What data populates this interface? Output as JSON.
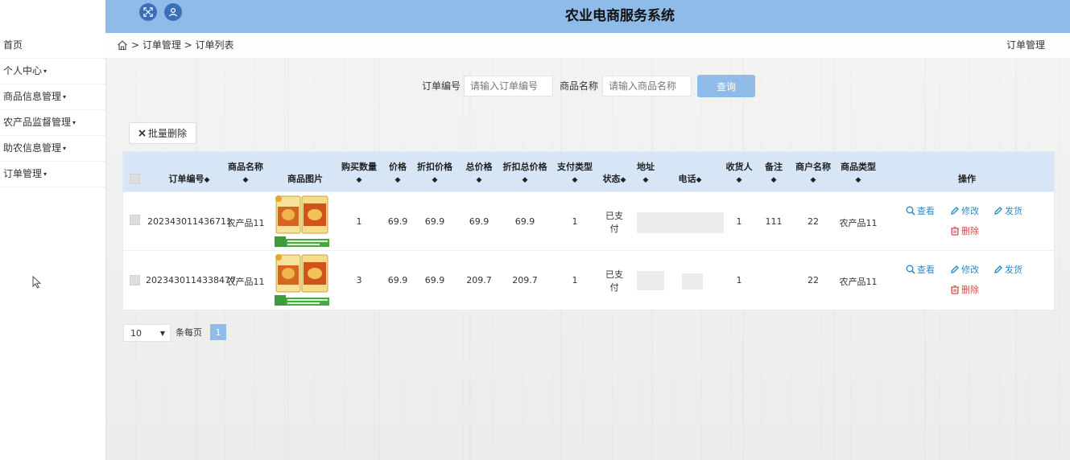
{
  "app": {
    "title": "农业电商服务系统"
  },
  "sidebar": {
    "items": [
      {
        "label": "首页",
        "caret": false
      },
      {
        "label": "个人中心",
        "caret": true
      },
      {
        "label": "商品信息管理",
        "caret": true
      },
      {
        "label": "农产品监督管理",
        "caret": true
      },
      {
        "label": "助农信息管理",
        "caret": true
      },
      {
        "label": "订单管理",
        "caret": true
      }
    ],
    "caret_glyph": "▾"
  },
  "breadcrumb": {
    "path": "> 订单管理 > 订单列表",
    "right_label": "订单管理"
  },
  "search": {
    "order_no_label": "订单编号",
    "order_no_placeholder": "请输入订单编号",
    "goods_name_label": "商品名称",
    "goods_name_placeholder": "请输入商品名称",
    "query_label": "查询"
  },
  "toolbar": {
    "batch_delete_label": "批量删除"
  },
  "table": {
    "sort_glyph": "◆",
    "columns": {
      "order_no": "订单编号",
      "goods_name": "商品名称",
      "goods_image": "商品图片",
      "quantity": "购买数量",
      "price": "价格",
      "discount_price": "折扣价格",
      "total": "总价格",
      "discount_total": "折扣总价格",
      "pay_type": "支付类型",
      "status": "状态",
      "address": "地址",
      "phone": "电话",
      "receiver": "收货人",
      "remark": "备注",
      "merchant": "商户名称",
      "goods_type": "商品类型",
      "actions": "操作"
    },
    "rows": [
      {
        "order_no": "202343011436711",
        "goods_name": "农产品11",
        "quantity": "1",
        "price": "69.9",
        "discount_price": "69.9",
        "total": "69.9",
        "discount_total": "69.9",
        "pay_type": "1",
        "status_l1": "已支",
        "status_l2": "付",
        "receiver": "1",
        "remark": "111",
        "merchant": "22",
        "goods_type": "农产品11"
      },
      {
        "order_no": "2023430114338477",
        "goods_name": "农产品11",
        "quantity": "3",
        "price": "69.9",
        "discount_price": "69.9",
        "total": "209.7",
        "discount_total": "209.7",
        "pay_type": "1",
        "status_l1": "已支",
        "status_l2": "付",
        "receiver": "1",
        "remark": "",
        "merchant": "22",
        "goods_type": "农产品11"
      }
    ],
    "actions": {
      "view": "查看",
      "edit": "修改",
      "ship": "发货",
      "delete": "删除"
    }
  },
  "pagination": {
    "page_size": "10",
    "per_page_label": "条每页",
    "current_page": "1"
  },
  "colors": {
    "header": "#8fbbe8",
    "accent": "#3b70b8",
    "link": "#2a8ac8",
    "danger": "#d54a4a"
  }
}
